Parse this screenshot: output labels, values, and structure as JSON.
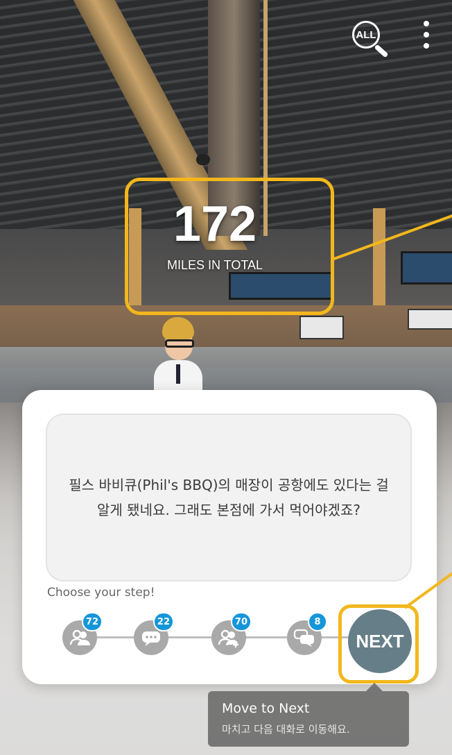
{
  "header": {
    "search_all_label": "ALL",
    "search_all_icon": "search-all-icon",
    "menu_icon": "more-vertical-icon"
  },
  "miles": {
    "total": "172",
    "label": "MILES IN TOTAL"
  },
  "dialog": {
    "message": "필스 바비큐(Phil's BBQ)의 매장이 공항에도 있다는 걸 알게 됐네요. 그래도 본점에 가서 먹어야겠죠?",
    "choose_label": "Choose your step!",
    "steps": [
      {
        "icon": "people-icon",
        "count": "72"
      },
      {
        "icon": "chat-bubble-icon",
        "count": "22"
      },
      {
        "icon": "add-people-icon",
        "count": "70"
      },
      {
        "icon": "speech-bubbles-icon",
        "count": "8"
      }
    ],
    "next_label": "NEXT"
  },
  "tooltip": {
    "title": "Move to Next",
    "subtitle": "마치고 다음 대화로 이동해요."
  },
  "colors": {
    "highlight": "#f3b71c",
    "badge": "#1596d9",
    "next_button": "#667e88",
    "step_icon": "#a9a9a9"
  }
}
